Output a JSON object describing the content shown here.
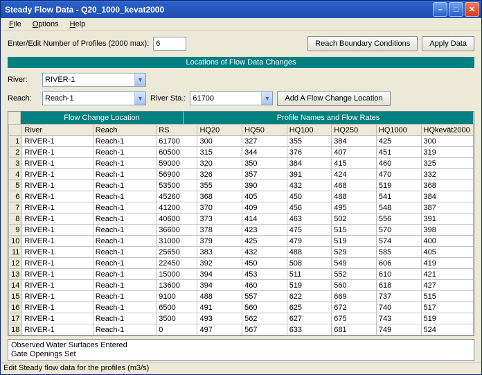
{
  "window": {
    "title": "Steady Flow Data - Q20_1000_kevat2000"
  },
  "menu": {
    "file": "File",
    "options": "Options",
    "help": "Help"
  },
  "toolbar": {
    "profiles_label": "Enter/Edit Number of Profiles (2000 max):",
    "profiles_value": "6",
    "reach_boundary": "Reach Boundary Conditions",
    "apply_data": "Apply Data"
  },
  "section_header": "Locations of Flow Data Changes",
  "selectors": {
    "river_label": "River:",
    "river_value": "RIVER-1",
    "reach_label": "Reach:",
    "reach_value": "Reach-1",
    "river_sta_label": "River Sta.:",
    "river_sta_value": "61700",
    "add_loc_btn": "Add A Flow Change Location"
  },
  "table": {
    "group_h1": "Flow Change Location",
    "group_h2": "Profile Names and Flow Rates",
    "cols": {
      "river": "River",
      "reach": "Reach",
      "rs": "RS",
      "hq20": "HQ20",
      "hq50": "HQ50",
      "hq100": "HQ100",
      "hq250": "HQ250",
      "hq1000": "HQ1000",
      "hqkevat": "HQkevät2000"
    },
    "rows": [
      {
        "n": "1",
        "river": "RIVER-1",
        "reach": "Reach-1",
        "rs": "61700",
        "q": [
          "300",
          "327",
          "355",
          "384",
          "425",
          "300"
        ]
      },
      {
        "n": "2",
        "river": "RIVER-1",
        "reach": "Reach-1",
        "rs": "60500",
        "q": [
          "315",
          "344",
          "376",
          "407",
          "451",
          "319"
        ]
      },
      {
        "n": "3",
        "river": "RIVER-1",
        "reach": "Reach-1",
        "rs": "59000",
        "q": [
          "320",
          "350",
          "384",
          "415",
          "460",
          "325"
        ]
      },
      {
        "n": "4",
        "river": "RIVER-1",
        "reach": "Reach-1",
        "rs": "56900",
        "q": [
          "326",
          "357",
          "391",
          "424",
          "470",
          "332"
        ]
      },
      {
        "n": "5",
        "river": "RIVER-1",
        "reach": "Reach-1",
        "rs": "53500",
        "q": [
          "355",
          "390",
          "432",
          "468",
          "519",
          "368"
        ]
      },
      {
        "n": "6",
        "river": "RIVER-1",
        "reach": "Reach-1",
        "rs": "45260",
        "q": [
          "368",
          "405",
          "450",
          "488",
          "541",
          "384"
        ]
      },
      {
        "n": "7",
        "river": "RIVER-1",
        "reach": "Reach-1",
        "rs": "41200",
        "q": [
          "370",
          "409",
          "456",
          "495",
          "548",
          "387"
        ]
      },
      {
        "n": "8",
        "river": "RIVER-1",
        "reach": "Reach-1",
        "rs": "40600",
        "q": [
          "373",
          "414",
          "463",
          "502",
          "556",
          "391"
        ]
      },
      {
        "n": "9",
        "river": "RIVER-1",
        "reach": "Reach-1",
        "rs": "36600",
        "q": [
          "378",
          "423",
          "475",
          "515",
          "570",
          "398"
        ]
      },
      {
        "n": "10",
        "river": "RIVER-1",
        "reach": "Reach-1",
        "rs": "31000",
        "q": [
          "379",
          "425",
          "479",
          "519",
          "574",
          "400"
        ]
      },
      {
        "n": "11",
        "river": "RIVER-1",
        "reach": "Reach-1",
        "rs": "25650",
        "q": [
          "383",
          "432",
          "488",
          "529",
          "585",
          "405"
        ]
      },
      {
        "n": "12",
        "river": "RIVER-1",
        "reach": "Reach-1",
        "rs": "22450",
        "q": [
          "392",
          "450",
          "508",
          "549",
          "606",
          "419"
        ]
      },
      {
        "n": "13",
        "river": "RIVER-1",
        "reach": "Reach-1",
        "rs": "15000",
        "q": [
          "394",
          "453",
          "511",
          "552",
          "610",
          "421"
        ]
      },
      {
        "n": "14",
        "river": "RIVER-1",
        "reach": "Reach-1",
        "rs": "13600",
        "q": [
          "394",
          "460",
          "519",
          "560",
          "618",
          "427"
        ]
      },
      {
        "n": "15",
        "river": "RIVER-1",
        "reach": "Reach-1",
        "rs": "9100",
        "q": [
          "488",
          "557",
          "622",
          "669",
          "737",
          "515"
        ]
      },
      {
        "n": "16",
        "river": "RIVER-1",
        "reach": "Reach-1",
        "rs": "6500",
        "q": [
          "491",
          "560",
          "625",
          "672",
          "740",
          "517"
        ]
      },
      {
        "n": "17",
        "river": "RIVER-1",
        "reach": "Reach-1",
        "rs": "3500",
        "q": [
          "493",
          "562",
          "627",
          "675",
          "743",
          "519"
        ]
      },
      {
        "n": "18",
        "river": "RIVER-1",
        "reach": "Reach-1",
        "rs": "0",
        "q": [
          "497",
          "567",
          "633",
          "681",
          "749",
          "524"
        ]
      }
    ]
  },
  "footer": {
    "line1": "Observed Water Surfaces Entered",
    "line2": "Gate Openings Set"
  },
  "status": "Edit Steady flow data for the profiles (m3/s)"
}
